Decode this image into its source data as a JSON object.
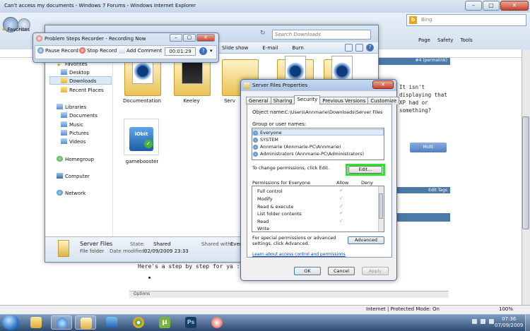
{
  "ie": {
    "title": "Can't access my documents - Windows 7 Forums - Windows Internet Explorer",
    "favorites": "Favorites",
    "search_placeholder": "Bing",
    "commands": [
      "Page",
      "Safety",
      "Tools"
    ],
    "status_zone": "Internet | Protected Mode: On",
    "zoom": "100%"
  },
  "webpage": {
    "post_tag": "#4 (permalink)",
    "quote_text": "It isn't displaying that XP had or something?",
    "multi_button": "Multi",
    "edit_tags": "Edit Tags",
    "body_text": "Here's a step by step for ya :)",
    "options_label": "Options"
  },
  "psr": {
    "title": "Problem Steps Recorder - Recording Now",
    "pause": "Pause Record",
    "stop": "Stop Record",
    "add_comment": "Add Comment",
    "timer": "00:01:29"
  },
  "explorer": {
    "search_placeholder": "Search Downloads",
    "commands": [
      "Slide show",
      "E-mail",
      "Burn"
    ],
    "nav": {
      "favorites": "Favorites",
      "desktop": "Desktop",
      "downloads": "Downloads",
      "recent": "Recent Places",
      "libraries": "Libraries",
      "documents": "Documents",
      "music": "Music",
      "pictures": "Pictures",
      "videos": "Videos",
      "homegroup": "Homegroup",
      "computer": "Computer",
      "network": "Network"
    },
    "files": [
      "Documentation",
      "Keeley",
      "Serv",
      "gamebooster"
    ],
    "details": {
      "name": "Server Files",
      "type": "File folder",
      "state_label": "State:",
      "state_value": "Shared",
      "modified_label": "Date modified:",
      "modified_value": "02/09/2009 23:33",
      "shared_label": "Shared with:",
      "shared_value": "Every"
    }
  },
  "dialog": {
    "title": "Server Files Properties",
    "tabs": [
      "General",
      "Sharing",
      "Security",
      "Previous Versions",
      "Customize"
    ],
    "object_label": "Object name:",
    "object_value": "C:\\Users\\Annmarie\\Downloads\\Server Files",
    "group_label": "Group or user names:",
    "groups": [
      "Everyone",
      "SYSTEM",
      "Annmarie (Annmarie-PC\\Annmarie)",
      "Administrators (Annmarie-PC\\Administrators)"
    ],
    "change_text": "To change permissions, click Edit.",
    "edit_button": "Edit...",
    "perm_label": "Permissions for Everyone",
    "allow": "Allow",
    "deny": "Deny",
    "permissions": [
      "Full control",
      "Modify",
      "Read & execute",
      "List folder contents",
      "Read",
      "Write"
    ],
    "check": "✓",
    "special_text": "For special permissions or advanced settings, click Advanced.",
    "advanced_button": "Advanced",
    "learn_link": "Learn about access control and permissions",
    "ok": "OK",
    "cancel": "Cancel",
    "apply": "Apply"
  },
  "taskbar": {
    "time": "07:36",
    "date": "07/09/2009"
  }
}
